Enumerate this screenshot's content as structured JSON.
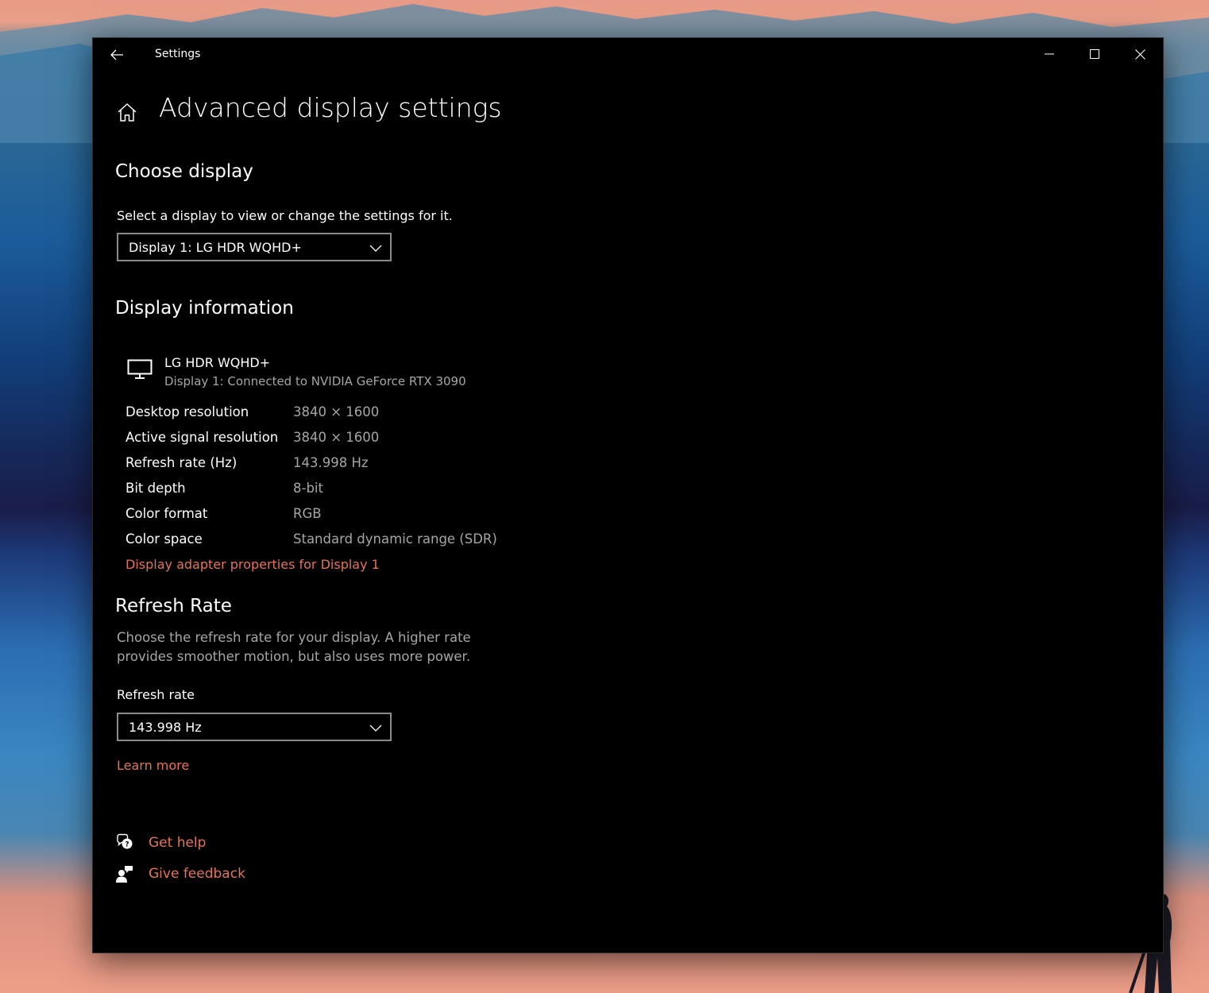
{
  "window": {
    "app_title": "Settings"
  },
  "page": {
    "title": "Advanced display settings"
  },
  "choose_display": {
    "heading": "Choose display",
    "prompt": "Select a display to view or change the settings for it.",
    "selected_display": "Display 1: LG HDR WQHD+"
  },
  "display_info": {
    "heading": "Display information",
    "monitor_name": "LG HDR WQHD+",
    "monitor_subtitle": "Display 1: Connected to NVIDIA GeForce RTX 3090",
    "rows": [
      {
        "label": "Desktop resolution",
        "value": "3840 × 1600"
      },
      {
        "label": "Active signal resolution",
        "value": "3840 × 1600"
      },
      {
        "label": "Refresh rate (Hz)",
        "value": "143.998 Hz"
      },
      {
        "label": "Bit depth",
        "value": "8-bit"
      },
      {
        "label": "Color format",
        "value": "RGB"
      },
      {
        "label": "Color space",
        "value": "Standard dynamic range (SDR)"
      }
    ],
    "adapter_link": "Display adapter properties for Display 1"
  },
  "refresh_rate": {
    "heading": "Refresh Rate",
    "description": "Choose the refresh rate for your display. A higher rate provides smoother motion, but also uses more power.",
    "field_label": "Refresh rate",
    "selected_rate": "143.998 Hz",
    "learn_more": "Learn more"
  },
  "help": {
    "get_help": "Get help",
    "give_feedback": "Give feedback"
  },
  "colors": {
    "accent_link": "#e4735a",
    "window_bg": "#000000",
    "secondary_text": "#a6a6a6"
  },
  "icons": [
    "back-arrow-icon",
    "minimize-icon",
    "maximize-icon",
    "close-icon",
    "home-icon",
    "chevron-down-icon",
    "monitor-icon",
    "help-chat-icon",
    "feedback-icon"
  ]
}
